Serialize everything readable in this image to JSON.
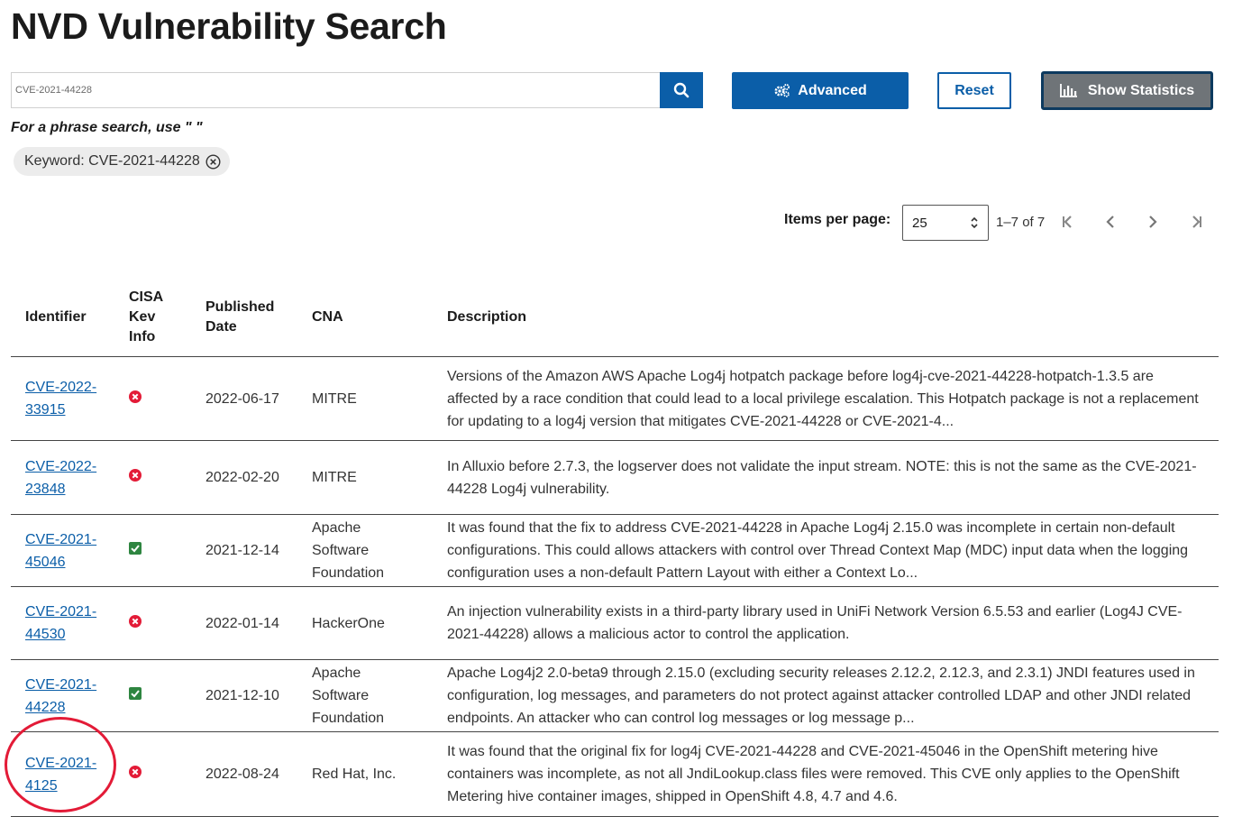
{
  "page_title": "NVD Vulnerability Search",
  "search": {
    "value": "CVE-2021-44228",
    "icon": "search-icon"
  },
  "buttons": {
    "advanced": "Advanced",
    "advanced_icon": "gears-icon",
    "reset": "Reset",
    "statistics": "Show Statistics",
    "statistics_icon": "bar-chart-icon"
  },
  "hint": "For a phrase search, use \" \"",
  "filter_chip": {
    "label": "Keyword: CVE-2021-44228",
    "icon": "close-circle-icon"
  },
  "pagination": {
    "items_per_page_label": "Items per page:",
    "items_per_page": "25",
    "range": "1–7 of 7",
    "icons": [
      "first-page-icon",
      "previous-page-icon",
      "next-page-icon",
      "last-page-icon"
    ]
  },
  "colors": {
    "primary": "#0b5ea8",
    "kev_no": "#e31b37",
    "kev_yes": "#2e8540",
    "annotation": "#e31b37"
  },
  "table": {
    "headers": {
      "identifier": "Identifier",
      "kev": "CISA Kev Info",
      "published": "Published Date",
      "cna": "CNA",
      "description": "Description"
    },
    "rows": [
      {
        "id_line1": "CVE-2022-",
        "id_line2": "33915",
        "kev": "no",
        "kev_icon": "x-circle-icon",
        "published": "2022-06-17",
        "cna_lines": [
          "MITRE"
        ],
        "description": "Versions of the Amazon AWS Apache Log4j hotpatch package before log4j-cve-2021-44228-hotpatch-1.3.5 are affected by a race condition that could lead to a local privilege escalation. This Hotpatch package is not a replacement for updating to a log4j version that mitigates CVE-2021-44228 or CVE-2021-4..."
      },
      {
        "id_line1": "CVE-2022-",
        "id_line2": "23848",
        "kev": "no",
        "kev_icon": "x-circle-icon",
        "published": "2022-02-20",
        "cna_lines": [
          "MITRE"
        ],
        "description": "In Alluxio before 2.7.3, the logserver does not validate the input stream. NOTE: this is not the same as the CVE-2021-44228 Log4j vulnerability."
      },
      {
        "id_line1": "CVE-2021-",
        "id_line2": "45046",
        "kev": "yes",
        "kev_icon": "check-square-icon",
        "published": "2021-12-14",
        "cna_lines": [
          "Apache",
          "Software",
          "Foundation"
        ],
        "description": "It was found that the fix to address CVE-2021-44228 in Apache Log4j 2.15.0 was incomplete in certain non-default configurations. This could allows attackers with control over Thread Context Map (MDC) input data when the logging configuration uses a non-default Pattern Layout with either a Context Lo..."
      },
      {
        "id_line1": "CVE-2021-",
        "id_line2": "44530",
        "kev": "no",
        "kev_icon": "x-circle-icon",
        "published": "2022-01-14",
        "cna_lines": [
          "HackerOne"
        ],
        "description": "An injection vulnerability exists in a third-party library used in UniFi Network Version 6.5.53 and earlier (Log4J CVE-2021-44228) allows a malicious actor to control the application."
      },
      {
        "id_line1": "CVE-2021-",
        "id_line2": "44228",
        "kev": "yes",
        "kev_icon": "check-square-icon",
        "published": "2021-12-10",
        "cna_lines": [
          "Apache",
          "Software",
          "Foundation"
        ],
        "description": "Apache Log4j2 2.0-beta9 through 2.15.0 (excluding security releases 2.12.2, 2.12.3, and 2.3.1) JNDI features used in configuration, log messages, and parameters do not protect against attacker controlled LDAP and other JNDI related endpoints. An attacker who can control log messages or log message p..."
      },
      {
        "id_line1": "CVE-2021-",
        "id_line2": "4125",
        "kev": "no",
        "kev_icon": "x-circle-icon",
        "published": "2022-08-24",
        "cna_lines": [
          "Red Hat, Inc."
        ],
        "description": "It was found that the original fix for log4j CVE-2021-44228 and CVE-2021-45046 in the OpenShift metering hive containers was incomplete, as not all JndiLookup.class files were removed. This CVE only applies to the OpenShift Metering hive container images, shipped in OpenShift 4.8, 4.7 and 4.6."
      }
    ]
  }
}
